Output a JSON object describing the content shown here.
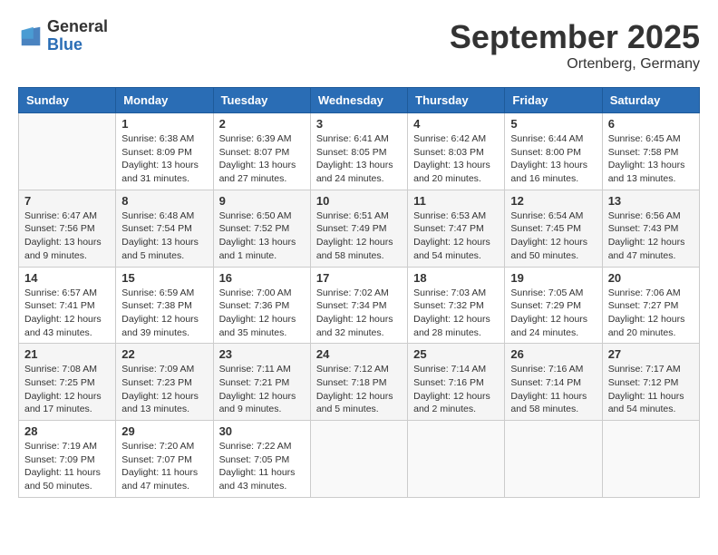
{
  "header": {
    "logo_general": "General",
    "logo_blue": "Blue",
    "month_title": "September 2025",
    "location": "Ortenberg, Germany"
  },
  "days_of_week": [
    "Sunday",
    "Monday",
    "Tuesday",
    "Wednesday",
    "Thursday",
    "Friday",
    "Saturday"
  ],
  "weeks": [
    [
      {
        "day": "",
        "info": ""
      },
      {
        "day": "1",
        "info": "Sunrise: 6:38 AM\nSunset: 8:09 PM\nDaylight: 13 hours\nand 31 minutes."
      },
      {
        "day": "2",
        "info": "Sunrise: 6:39 AM\nSunset: 8:07 PM\nDaylight: 13 hours\nand 27 minutes."
      },
      {
        "day": "3",
        "info": "Sunrise: 6:41 AM\nSunset: 8:05 PM\nDaylight: 13 hours\nand 24 minutes."
      },
      {
        "day": "4",
        "info": "Sunrise: 6:42 AM\nSunset: 8:03 PM\nDaylight: 13 hours\nand 20 minutes."
      },
      {
        "day": "5",
        "info": "Sunrise: 6:44 AM\nSunset: 8:00 PM\nDaylight: 13 hours\nand 16 minutes."
      },
      {
        "day": "6",
        "info": "Sunrise: 6:45 AM\nSunset: 7:58 PM\nDaylight: 13 hours\nand 13 minutes."
      }
    ],
    [
      {
        "day": "7",
        "info": "Sunrise: 6:47 AM\nSunset: 7:56 PM\nDaylight: 13 hours\nand 9 minutes."
      },
      {
        "day": "8",
        "info": "Sunrise: 6:48 AM\nSunset: 7:54 PM\nDaylight: 13 hours\nand 5 minutes."
      },
      {
        "day": "9",
        "info": "Sunrise: 6:50 AM\nSunset: 7:52 PM\nDaylight: 13 hours\nand 1 minute."
      },
      {
        "day": "10",
        "info": "Sunrise: 6:51 AM\nSunset: 7:49 PM\nDaylight: 12 hours\nand 58 minutes."
      },
      {
        "day": "11",
        "info": "Sunrise: 6:53 AM\nSunset: 7:47 PM\nDaylight: 12 hours\nand 54 minutes."
      },
      {
        "day": "12",
        "info": "Sunrise: 6:54 AM\nSunset: 7:45 PM\nDaylight: 12 hours\nand 50 minutes."
      },
      {
        "day": "13",
        "info": "Sunrise: 6:56 AM\nSunset: 7:43 PM\nDaylight: 12 hours\nand 47 minutes."
      }
    ],
    [
      {
        "day": "14",
        "info": "Sunrise: 6:57 AM\nSunset: 7:41 PM\nDaylight: 12 hours\nand 43 minutes."
      },
      {
        "day": "15",
        "info": "Sunrise: 6:59 AM\nSunset: 7:38 PM\nDaylight: 12 hours\nand 39 minutes."
      },
      {
        "day": "16",
        "info": "Sunrise: 7:00 AM\nSunset: 7:36 PM\nDaylight: 12 hours\nand 35 minutes."
      },
      {
        "day": "17",
        "info": "Sunrise: 7:02 AM\nSunset: 7:34 PM\nDaylight: 12 hours\nand 32 minutes."
      },
      {
        "day": "18",
        "info": "Sunrise: 7:03 AM\nSunset: 7:32 PM\nDaylight: 12 hours\nand 28 minutes."
      },
      {
        "day": "19",
        "info": "Sunrise: 7:05 AM\nSunset: 7:29 PM\nDaylight: 12 hours\nand 24 minutes."
      },
      {
        "day": "20",
        "info": "Sunrise: 7:06 AM\nSunset: 7:27 PM\nDaylight: 12 hours\nand 20 minutes."
      }
    ],
    [
      {
        "day": "21",
        "info": "Sunrise: 7:08 AM\nSunset: 7:25 PM\nDaylight: 12 hours\nand 17 minutes."
      },
      {
        "day": "22",
        "info": "Sunrise: 7:09 AM\nSunset: 7:23 PM\nDaylight: 12 hours\nand 13 minutes."
      },
      {
        "day": "23",
        "info": "Sunrise: 7:11 AM\nSunset: 7:21 PM\nDaylight: 12 hours\nand 9 minutes."
      },
      {
        "day": "24",
        "info": "Sunrise: 7:12 AM\nSunset: 7:18 PM\nDaylight: 12 hours\nand 5 minutes."
      },
      {
        "day": "25",
        "info": "Sunrise: 7:14 AM\nSunset: 7:16 PM\nDaylight: 12 hours\nand 2 minutes."
      },
      {
        "day": "26",
        "info": "Sunrise: 7:16 AM\nSunset: 7:14 PM\nDaylight: 11 hours\nand 58 minutes."
      },
      {
        "day": "27",
        "info": "Sunrise: 7:17 AM\nSunset: 7:12 PM\nDaylight: 11 hours\nand 54 minutes."
      }
    ],
    [
      {
        "day": "28",
        "info": "Sunrise: 7:19 AM\nSunset: 7:09 PM\nDaylight: 11 hours\nand 50 minutes."
      },
      {
        "day": "29",
        "info": "Sunrise: 7:20 AM\nSunset: 7:07 PM\nDaylight: 11 hours\nand 47 minutes."
      },
      {
        "day": "30",
        "info": "Sunrise: 7:22 AM\nSunset: 7:05 PM\nDaylight: 11 hours\nand 43 minutes."
      },
      {
        "day": "",
        "info": ""
      },
      {
        "day": "",
        "info": ""
      },
      {
        "day": "",
        "info": ""
      },
      {
        "day": "",
        "info": ""
      }
    ]
  ]
}
